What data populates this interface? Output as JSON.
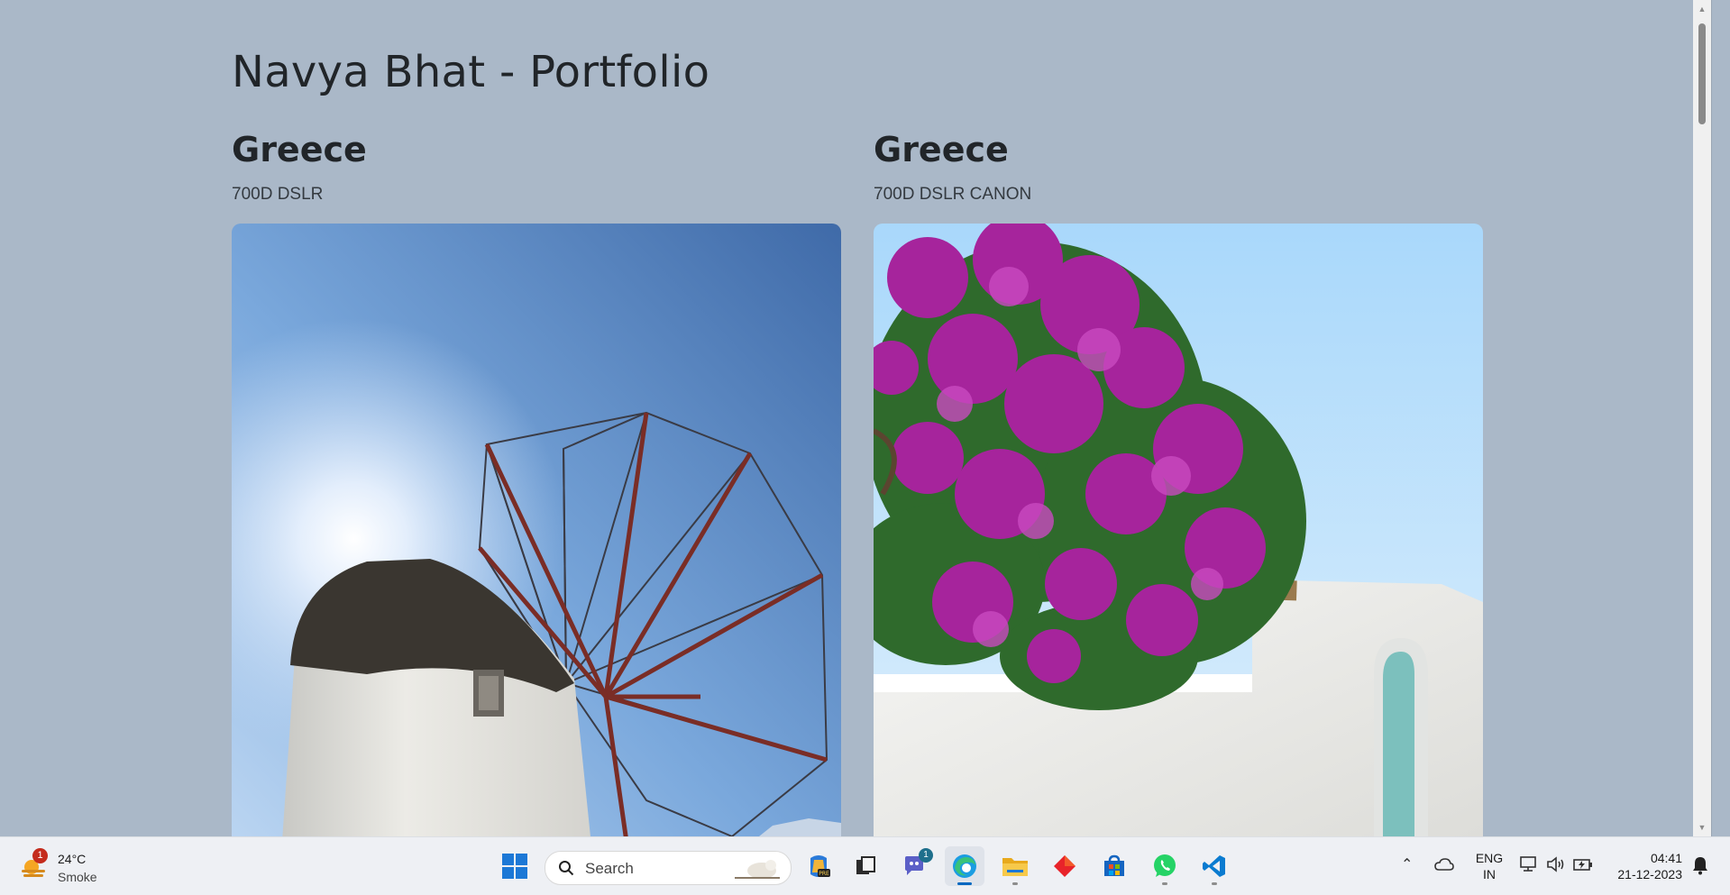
{
  "page": {
    "title": "Navya Bhat - Portfolio",
    "cards": [
      {
        "title": "Greece",
        "caption": "700D DSLR",
        "photo_subject": "windmill"
      },
      {
        "title": "Greece",
        "caption": "700D DSLR CANON",
        "photo_subject": "bougainvillea"
      }
    ]
  },
  "taskbar": {
    "weather": {
      "temp": "24°C",
      "condition": "Smoke",
      "badge": "1"
    },
    "search_placeholder": "Search",
    "teams_badge": "1",
    "language": {
      "line1": "ENG",
      "line2": "IN"
    },
    "clock": {
      "time": "04:41",
      "date": "21-12-2023"
    }
  },
  "colors": {
    "page_bg": "#aab8c8",
    "text": "#212529",
    "accent": "#0067c0"
  }
}
